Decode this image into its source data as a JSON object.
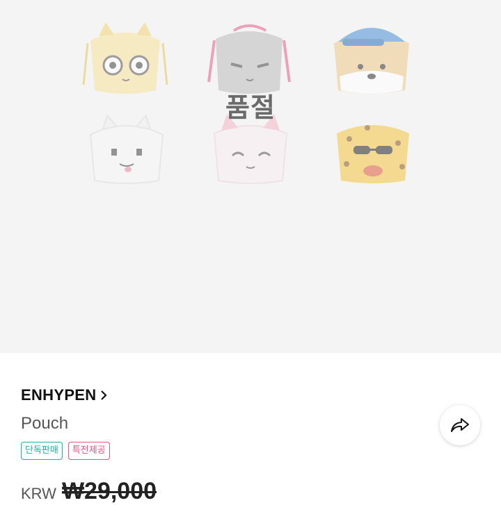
{
  "hero": {
    "soldout_label": "품절",
    "pouches": [
      {
        "name": "yellow-cat-pouch",
        "color": "#f6e7a6"
      },
      {
        "name": "gray-cat-pouch",
        "color": "#bdbdbd"
      },
      {
        "name": "dog-cap-pouch",
        "color": "#f3d089"
      },
      {
        "name": "white-cat-pouch",
        "color": "#f7f7f7"
      },
      {
        "name": "pink-fox-pouch",
        "color": "#f9e8ec"
      },
      {
        "name": "cheetah-pouch",
        "color": "#f4c542"
      }
    ]
  },
  "product": {
    "brand": "ENHYPEN",
    "name": "Pouch",
    "badges": [
      "단독판매",
      "특전제공"
    ],
    "currency": "KRW",
    "price": "₩29,000"
  },
  "colors": {
    "badge_teal": "#17b3a6",
    "badge_pink": "#e0577e"
  },
  "icons": {
    "brand_link": "chevron-right-icon",
    "share": "share-icon"
  }
}
